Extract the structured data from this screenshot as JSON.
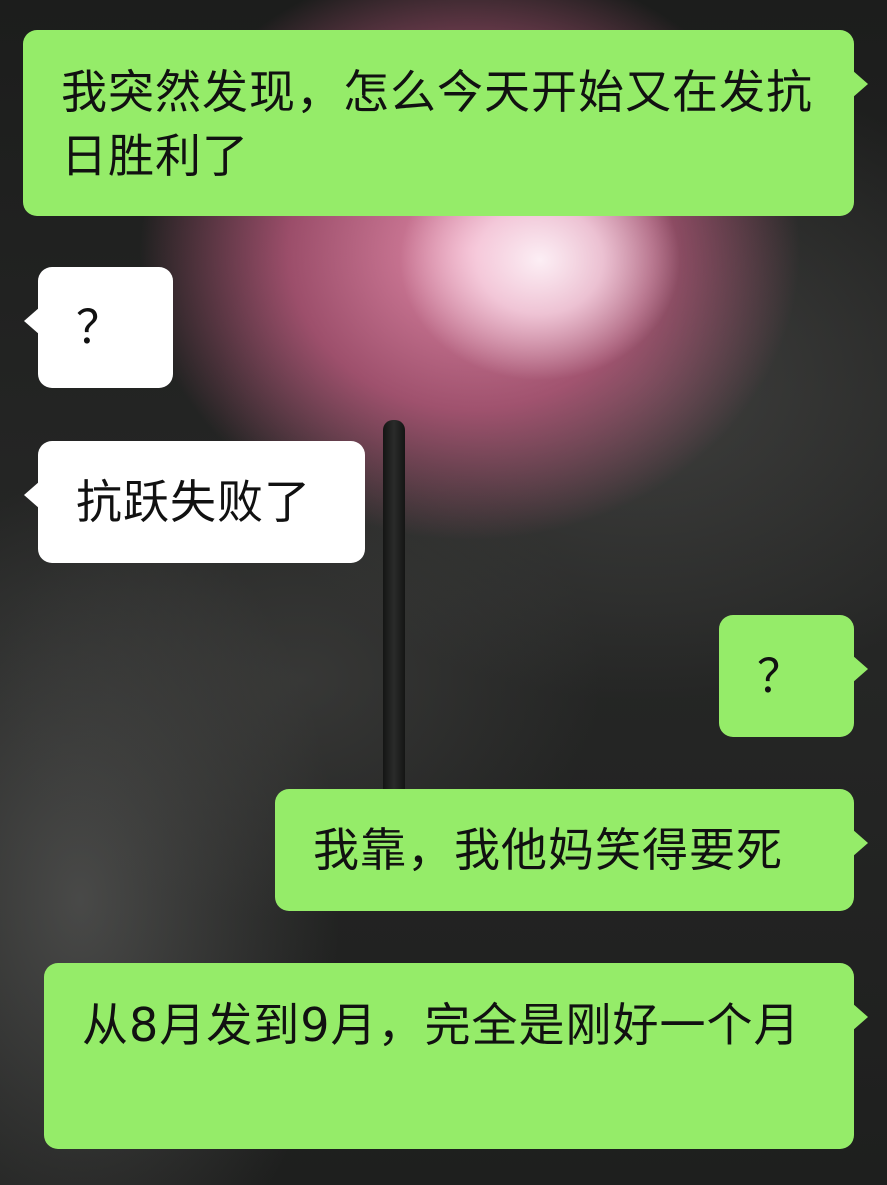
{
  "theme": {
    "outgoing_bubble_color": "#95ec69",
    "incoming_bubble_color": "#ffffff"
  },
  "chat": {
    "messages": [
      {
        "direction": "outgoing",
        "text": "我突然发现，怎么今天开始又在发抗日胜利了"
      },
      {
        "direction": "incoming",
        "text": "？"
      },
      {
        "direction": "incoming",
        "text": "抗跃失败了"
      },
      {
        "direction": "outgoing",
        "text": "？"
      },
      {
        "direction": "outgoing",
        "text": "我靠，我他妈笑得要死"
      },
      {
        "direction": "outgoing",
        "text": "从8月发到9月，完全是刚好一个月"
      }
    ]
  }
}
